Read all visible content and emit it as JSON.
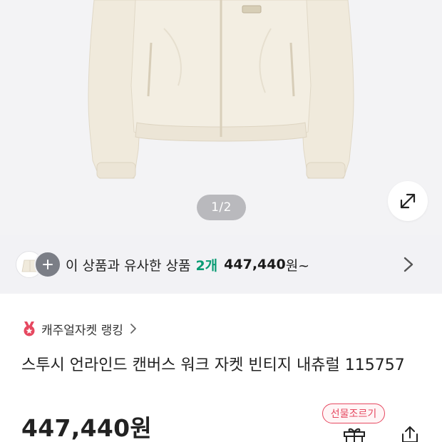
{
  "gallery": {
    "page_indicator": "1/2",
    "expand_icon": "expand-arrows-icon"
  },
  "similar": {
    "lead_text": "이 상품과 유사한 상품",
    "count": "2개",
    "price": "447,440",
    "suffix": "원~",
    "plus_icon": "plus-icon",
    "arrow_icon": "chevron-right-icon"
  },
  "ranking": {
    "label": "캐주얼자켓 랭킹",
    "badge_icon": "ranking-medal-icon",
    "accent": "#e64860"
  },
  "product": {
    "title": "스투시 언라인드 캔버스 워크 자켓 빈티지 내츄럴 115757",
    "price": "447,440원"
  },
  "actions": {
    "gift_label": "선물조르기",
    "gift_icon": "gift-icon",
    "share_icon": "share-icon",
    "accent": "#e64860"
  },
  "colors": {
    "similar_count": "#0a9c74",
    "bar_background": "#f2f2f5"
  }
}
